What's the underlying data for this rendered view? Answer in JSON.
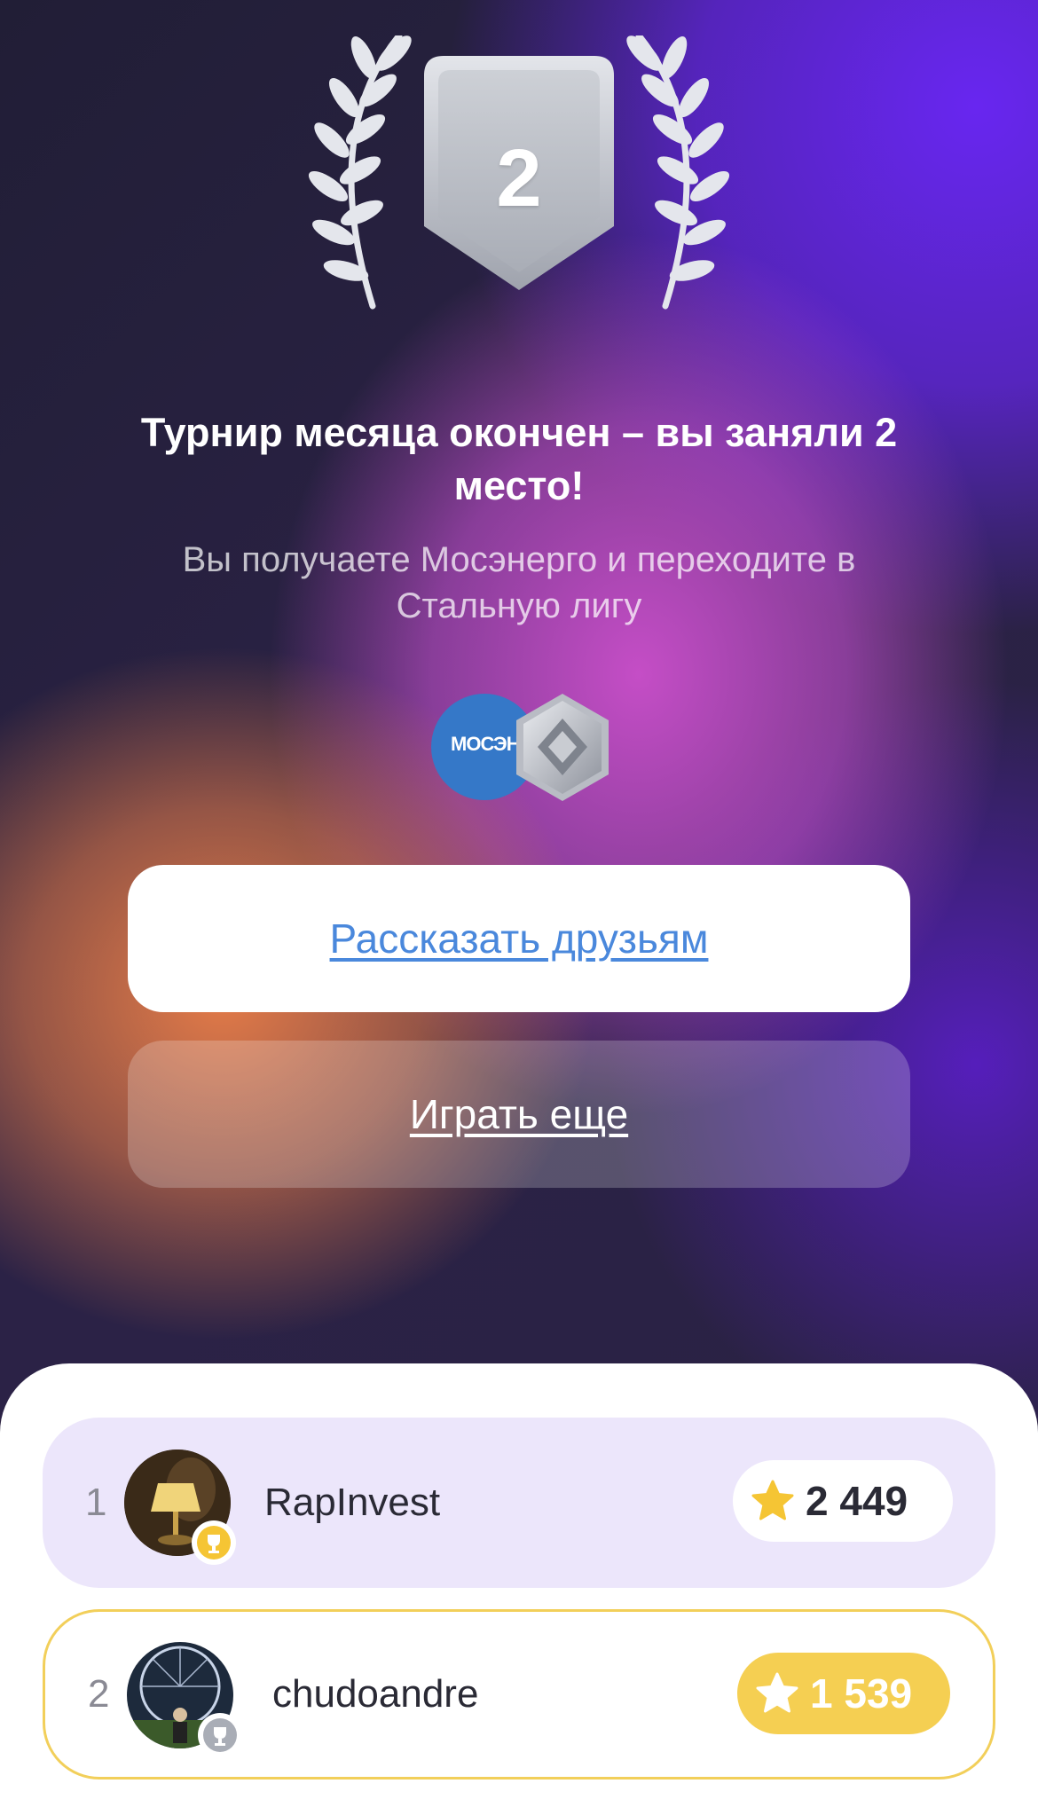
{
  "badge": {
    "place": "2",
    "icon": "silver-shield-with-laurels"
  },
  "result": {
    "title": "Турнир месяца окончен – вы заняли 2 место!",
    "subtitle": "Вы получаете Мосэнерго и переходите в Стальную лигу"
  },
  "rewards": {
    "company_logo_text": "МОСЭНЕРГО",
    "company_icon": "mosenergo-logo",
    "league_icon": "steel-league-hexagon"
  },
  "actions": {
    "share_label": "Рассказать друзьям",
    "play_again_label": "Играть еще"
  },
  "leaderboard": [
    {
      "rank": "1",
      "username": "RapInvest",
      "score": "2 449",
      "trophy": "gold-cup-icon"
    },
    {
      "rank": "2",
      "username": "chudoandre",
      "score": "1 539",
      "trophy": "silver-cup-icon"
    }
  ],
  "colors": {
    "accent_purple": "#6a2ff0",
    "link_blue": "#4a88dc",
    "highlight_yellow": "#f5cf52",
    "gold_star": "#f5c534",
    "current_row_border": "#f2cf5a",
    "first_row_bg": "#ece6fb"
  }
}
